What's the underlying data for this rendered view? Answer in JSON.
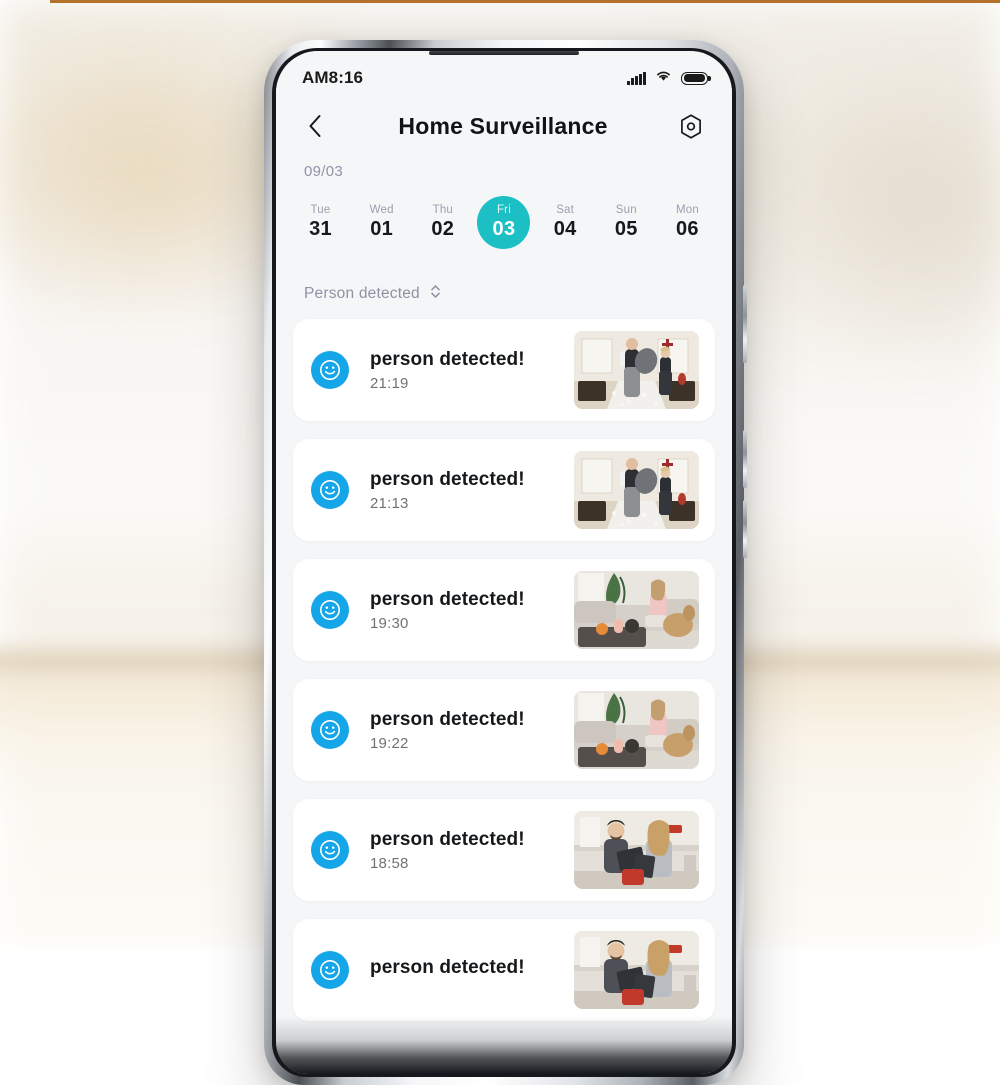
{
  "background": {
    "description": "blurred bright interior room",
    "accent_rule_color": "#b4712c"
  },
  "phone": {
    "frame_color": "#8e9298",
    "screen_bg": "#f5f6f7"
  },
  "status_bar": {
    "time": "AM8:16",
    "icons": [
      "signal-icon",
      "wifi-icon",
      "battery-icon"
    ]
  },
  "app_bar": {
    "back_icon": "chevron-left-icon",
    "title": "Home  Surveillance",
    "settings_icon": "hex-settings-icon"
  },
  "date_strip": {
    "month_label": "09/03",
    "accent_color": "#1cbfc4",
    "days": [
      {
        "dow": "Tue",
        "num": "31",
        "active": false
      },
      {
        "dow": "Wed",
        "num": "01",
        "active": false
      },
      {
        "dow": "Thu",
        "num": "02",
        "active": false
      },
      {
        "dow": "Fri",
        "num": "03",
        "active": true
      },
      {
        "dow": "Sat",
        "num": "04",
        "active": false
      },
      {
        "dow": "Sun",
        "num": "05",
        "active": false
      },
      {
        "dow": "Mon",
        "num": "06",
        "active": false
      }
    ]
  },
  "filter": {
    "label": "Person detected",
    "icon": "sort-updown-icon"
  },
  "events": {
    "icon_color": "#14a6e8",
    "icon_name": "smiley-face-icon",
    "items": [
      {
        "title": "person detected!",
        "time": "21:19",
        "thumb": "pillow-fight-bedroom"
      },
      {
        "title": "person detected!",
        "time": "21:13",
        "thumb": "pillow-fight-bedroom"
      },
      {
        "title": "person detected!",
        "time": "19:30",
        "thumb": "woman-dog-livingroom"
      },
      {
        "title": "person detected!",
        "time": "19:22",
        "thumb": "woman-dog-livingroom"
      },
      {
        "title": "person detected!",
        "time": "18:58",
        "thumb": "couple-kitchen"
      },
      {
        "title": "person detected!",
        "time": "",
        "thumb": "couple-kitchen"
      }
    ]
  }
}
